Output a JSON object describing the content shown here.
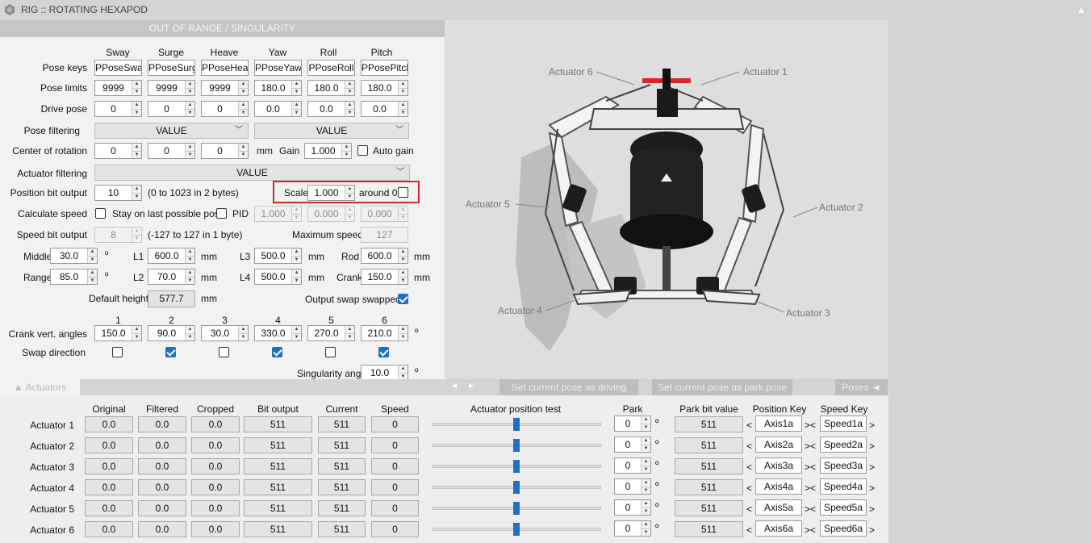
{
  "app": {
    "title": "RIG :: ROTATING HEXAPOD",
    "collapse_glyph": "▲"
  },
  "panel": {
    "header": "OUT OF RANGE / SINGULARITY"
  },
  "axes": [
    "Sway",
    "Surge",
    "Heave",
    "Yaw",
    "Roll",
    "Pitch"
  ],
  "pose_keys": {
    "label": "Pose keys",
    "values": [
      "PPoseSway",
      "PPoseSurge",
      "PPoseHeave",
      "PPoseYaw",
      "PPoseRoll",
      "PPosePitch"
    ]
  },
  "pose_limits": {
    "label": "Pose limits",
    "values": [
      "9999",
      "9999",
      "9999",
      "180.0",
      "180.0",
      "180.0"
    ]
  },
  "drive_pose": {
    "label": "Drive pose",
    "values": [
      "0",
      "0",
      "0",
      "0.0",
      "0.0",
      "0.0"
    ]
  },
  "pose_filtering": {
    "label": "Pose filtering",
    "values": [
      "VALUE",
      "VALUE"
    ]
  },
  "center_rotation": {
    "label": "Center of rotation",
    "values": [
      "0",
      "0",
      "0"
    ],
    "unit": "mm",
    "gain_label": "Gain",
    "gain": "1.000",
    "auto_gain_label": "Auto gain"
  },
  "actuator_filtering": {
    "label": "Actuator filtering",
    "value": "VALUE"
  },
  "position_bit_output": {
    "label": "Position bit output",
    "value": "10",
    "range": "(0 to 1023 in 2 bytes)",
    "scale_label": "Scale",
    "scale": "1.000",
    "around_label": "around 0"
  },
  "calc_speed": {
    "label": "Calculate speed",
    "stay_label": "Stay on last possible pose",
    "pid_label": "PID",
    "pid": [
      "1.000",
      "0.000",
      "0.000"
    ]
  },
  "speed_bit_output": {
    "label": "Speed bit output",
    "value": "8",
    "range": "(-127 to 127 in 1 byte)",
    "max_label": "Maximum speed",
    "max": "127"
  },
  "geometry": {
    "middle_label": "Middle",
    "middle": "30.0",
    "range_label": "Range",
    "range": "85.0",
    "deg": "º",
    "l1_label": "L1",
    "l1": "600.0",
    "l2_label": "L2",
    "l2": "70.0",
    "l3_label": "L3",
    "l3": "500.0",
    "l4_label": "L4",
    "l4": "500.0",
    "rod_label": "Rod",
    "rod": "600.0",
    "crank_label": "Crank",
    "crank": "150.0",
    "mm": "mm"
  },
  "default_height": {
    "label": "Default height",
    "value": "577.7",
    "unit": "mm",
    "swap_label": "Output swap swapped"
  },
  "crank": {
    "indices": [
      "1",
      "2",
      "3",
      "4",
      "5",
      "6"
    ],
    "label": "Crank vert. angles",
    "values": [
      "150.0",
      "90.0",
      "30.0",
      "330.0",
      "270.0",
      "210.0"
    ],
    "unit": "º",
    "swap_label": "Swap direction",
    "swap": [
      false,
      true,
      false,
      true,
      false,
      true
    ]
  },
  "singularity": {
    "label": "Singularity angle",
    "value": "10.0",
    "unit": "º"
  },
  "figure": {
    "labels": [
      "Actuator 6",
      "Actuator 1",
      "Actuator 5",
      "Actuator 2",
      "Actuator 4",
      "Actuator 3"
    ]
  },
  "toolbar": {
    "actuators_tab": "▲  Actuators",
    "prev": "◄",
    "next": "►",
    "set_driving": "Set current pose as driving pose",
    "set_park": "Set current pose as park pose",
    "poses": "Poses  ◄"
  },
  "act_table": {
    "headers": {
      "original": "Original",
      "filtered": "Filtered",
      "cropped": "Cropped",
      "bit": "Bit output",
      "current": "Current",
      "speed": "Speed",
      "test": "Actuator position test",
      "park": "Park",
      "park_bit": "Park bit value",
      "pos_key": "Position Key",
      "speed_key": "Speed Key"
    },
    "rows": [
      {
        "name": "Actuator 1",
        "original": "0.0",
        "filtered": "0.0",
        "cropped": "0.0",
        "bit": "511",
        "current": "511",
        "speed": "0",
        "test": 0.5,
        "park": "0",
        "park_bit": "511",
        "pos_key": "Axis1a",
        "speed_key": "Speed1a"
      },
      {
        "name": "Actuator 2",
        "original": "0.0",
        "filtered": "0.0",
        "cropped": "0.0",
        "bit": "511",
        "current": "511",
        "speed": "0",
        "test": 0.5,
        "park": "0",
        "park_bit": "511",
        "pos_key": "Axis2a",
        "speed_key": "Speed2a"
      },
      {
        "name": "Actuator 3",
        "original": "0.0",
        "filtered": "0.0",
        "cropped": "0.0",
        "bit": "511",
        "current": "511",
        "speed": "0",
        "test": 0.5,
        "park": "0",
        "park_bit": "511",
        "pos_key": "Axis3a",
        "speed_key": "Speed3a"
      },
      {
        "name": "Actuator 4",
        "original": "0.0",
        "filtered": "0.0",
        "cropped": "0.0",
        "bit": "511",
        "current": "511",
        "speed": "0",
        "test": 0.5,
        "park": "0",
        "park_bit": "511",
        "pos_key": "Axis4a",
        "speed_key": "Speed4a"
      },
      {
        "name": "Actuator 5",
        "original": "0.0",
        "filtered": "0.0",
        "cropped": "0.0",
        "bit": "511",
        "current": "511",
        "speed": "0",
        "test": 0.5,
        "park": "0",
        "park_bit": "511",
        "pos_key": "Axis5a",
        "speed_key": "Speed5a"
      },
      {
        "name": "Actuator 6",
        "original": "0.0",
        "filtered": "0.0",
        "cropped": "0.0",
        "bit": "511",
        "current": "511",
        "speed": "0",
        "test": 0.5,
        "park": "0",
        "park_bit": "511",
        "pos_key": "Axis6a",
        "speed_key": "Speed6a"
      }
    ],
    "deg": "º",
    "lt": "<",
    "gt": ">",
    "mid": "><"
  },
  "colors": {
    "highlight": "#d9262c",
    "accent": "#1f6fc5"
  }
}
